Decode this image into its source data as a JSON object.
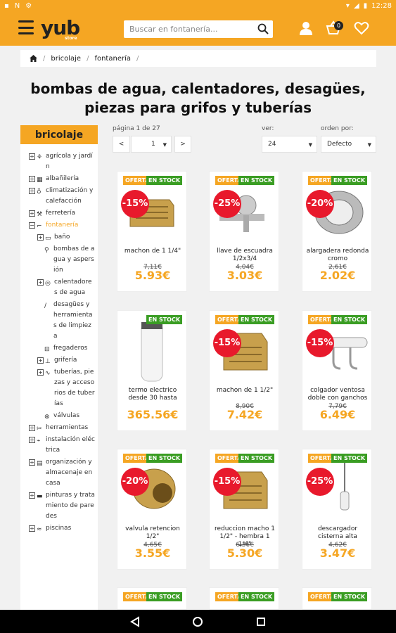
{
  "status": {
    "time": "12:28"
  },
  "header": {
    "logo": "yub",
    "logo_sub": "store",
    "search_placeholder": "Buscar en fontanería...",
    "cart_count": "0"
  },
  "breadcrumb": {
    "items": [
      "bricolaje",
      "fontanería"
    ]
  },
  "page_title_line1": "bombas de agua, calentadores, desagües,",
  "page_title_line2": "piezas para grifos y tuberías",
  "sidebar": {
    "title": "bricolaje",
    "tree": [
      {
        "label": "agrícola y jardín"
      },
      {
        "label": "albañilería"
      },
      {
        "label": "climatización y calefacción"
      },
      {
        "label": "ferretería"
      },
      {
        "label": "fontanería"
      },
      {
        "label": "baño"
      },
      {
        "label": "bombas de agua y aspersión"
      },
      {
        "label": "calentadores de agua"
      },
      {
        "label": "desagües y herramientas de limpieza"
      },
      {
        "label": "fregaderos"
      },
      {
        "label": "grifería"
      },
      {
        "label": "tuberías, piezas y accesorios de tuberías"
      },
      {
        "label": "válvulas"
      },
      {
        "label": "herramientas"
      },
      {
        "label": "instalación eléctrica"
      },
      {
        "label": "organización y almacenaje en casa"
      },
      {
        "label": "pinturas y tratamiento de paredes"
      },
      {
        "label": "piscinas"
      }
    ]
  },
  "controls": {
    "page_label": "página 1 de 27",
    "page_value": "1",
    "prev": "<",
    "next": ">",
    "ver_label": "ver:",
    "ver_value": "24",
    "order_label": "orden por:",
    "order_value": "Defecto"
  },
  "badges": {
    "oferta": "OFERTA",
    "stock": "EN STOCK"
  },
  "products": [
    {
      "name": "machon de 1 1/4\"",
      "old": "7,11€",
      "price": "5.93€",
      "discount": "-15%"
    },
    {
      "name": "llave de escuadra 1/2x3/4",
      "old": "4,04€",
      "price": "3.03€",
      "discount": "-25%"
    },
    {
      "name": "alargadera redonda cromo",
      "old": "2,61€",
      "price": "2.02€",
      "discount": "-20%"
    },
    {
      "name": "termo electrico desde 30 hasta",
      "old": "",
      "price": "365.56€",
      "discount": ""
    },
    {
      "name": "machon de 1 1/2\"",
      "old": "8,90€",
      "price": "7.42€",
      "discount": "-15%"
    },
    {
      "name": "colgador ventosa doble con ganchos",
      "old": "7,79€",
      "price": "6.49€",
      "discount": "-15%"
    },
    {
      "name": "valvula retencion 1/2\"",
      "old": "4,65€",
      "price": "3.55€",
      "discount": "-20%"
    },
    {
      "name": "reduccion macho 1 1/2\" - hembra 1 1/4\"",
      "old": "6,36€",
      "price": "5.30€",
      "discount": "-15%"
    },
    {
      "name": "descargador cisterna alta",
      "old": "4,62€",
      "price": "3.47€",
      "discount": "-25%"
    }
  ]
}
